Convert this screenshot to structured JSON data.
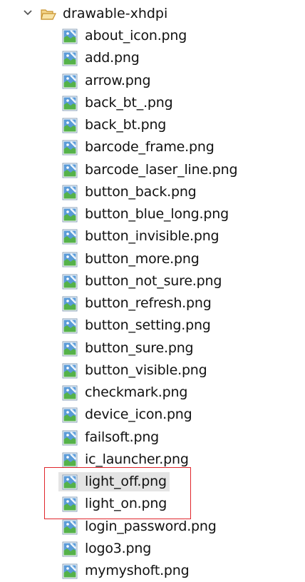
{
  "folder": {
    "name": "drawable-xhdpi",
    "icon": "folder-open-icon",
    "expanded": true
  },
  "files": [
    {
      "name": "about_icon.png",
      "selected": false
    },
    {
      "name": "add.png",
      "selected": false
    },
    {
      "name": "arrow.png",
      "selected": false
    },
    {
      "name": "back_bt_.png",
      "selected": false
    },
    {
      "name": "back_bt.png",
      "selected": false
    },
    {
      "name": "barcode_frame.png",
      "selected": false
    },
    {
      "name": "barcode_laser_line.png",
      "selected": false
    },
    {
      "name": "button_back.png",
      "selected": false
    },
    {
      "name": "button_blue_long.png",
      "selected": false
    },
    {
      "name": "button_invisible.png",
      "selected": false
    },
    {
      "name": "button_more.png",
      "selected": false
    },
    {
      "name": "button_not_sure.png",
      "selected": false
    },
    {
      "name": "button_refresh.png",
      "selected": false
    },
    {
      "name": "button_setting.png",
      "selected": false
    },
    {
      "name": "button_sure.png",
      "selected": false
    },
    {
      "name": "button_visible.png",
      "selected": false
    },
    {
      "name": "checkmark.png",
      "selected": false
    },
    {
      "name": "device_icon.png",
      "selected": false
    },
    {
      "name": "failsoft.png",
      "selected": false
    },
    {
      "name": "ic_launcher.png",
      "selected": false
    },
    {
      "name": "light_off.png",
      "selected": true
    },
    {
      "name": "light_on.png",
      "selected": false
    },
    {
      "name": "login_password.png",
      "selected": false
    },
    {
      "name": "logo3.png",
      "selected": false
    },
    {
      "name": "mymyshoft.png",
      "selected": false
    }
  ],
  "file_icon": "image-file-icon",
  "colors": {
    "highlight_border": "#e0262c",
    "selection_background": "#e4e4e4",
    "folder_icon": "#d9a23a",
    "image_icon_sky": "#4a90d9",
    "image_icon_grass": "#4caf50"
  }
}
